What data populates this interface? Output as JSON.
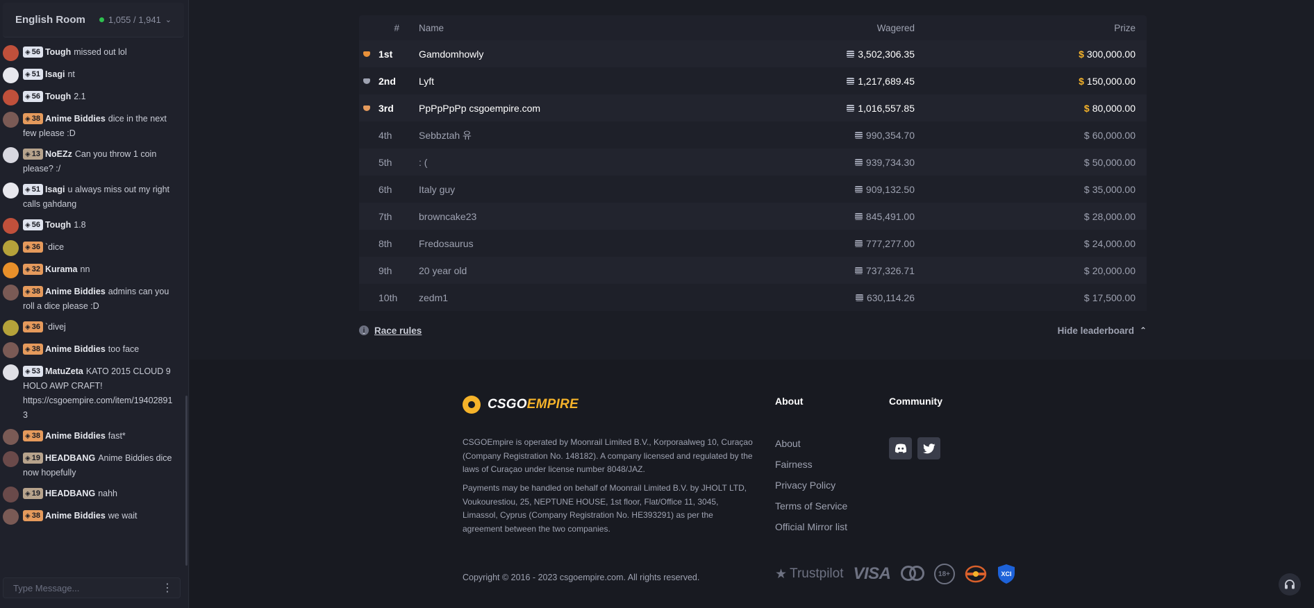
{
  "chat": {
    "room_title": "English Room",
    "online_count": "1,055 / 1,941",
    "input_placeholder": "Type Message...",
    "messages": [
      {
        "user": "Tough",
        "level": "56",
        "level_color": "silver",
        "avatar_color": "#c0503b",
        "text": "missed out lol"
      },
      {
        "user": "Isagi",
        "level": "51",
        "level_color": "silver",
        "avatar_color": "#e8e8ee",
        "text": "nt"
      },
      {
        "user": "Tough",
        "level": "56",
        "level_color": "silver",
        "avatar_color": "#c0503b",
        "text": "2.1"
      },
      {
        "user": "Anime Biddies",
        "level": "38",
        "level_color": "bronze",
        "avatar_color": "#7a5a55",
        "text": "dice in the next few please :D"
      },
      {
        "user": "NoEZz",
        "level": "13",
        "level_color": "tan",
        "avatar_color": "#d8d8e0",
        "text": "Can you throw 1 coin please? :/"
      },
      {
        "user": "Isagi",
        "level": "51",
        "level_color": "silver",
        "avatar_color": "#e8e8ee",
        "text": "u always miss out my right calls gahdang"
      },
      {
        "user": "Tough",
        "level": "56",
        "level_color": "silver",
        "avatar_color": "#c0503b",
        "text": "1.8"
      },
      {
        "user": "",
        "level": "36",
        "level_color": "bronze",
        "avatar_color": "#b5a23a",
        "text": "`dice"
      },
      {
        "user": "Kurama",
        "level": "32",
        "level_color": "bronze",
        "avatar_color": "#e8902a",
        "text": "nn"
      },
      {
        "user": "Anime Biddies",
        "level": "38",
        "level_color": "bronze",
        "avatar_color": "#7a5a55",
        "text": "admins can you roll a dice please :D"
      },
      {
        "user": "",
        "level": "36",
        "level_color": "bronze",
        "avatar_color": "#b5a23a",
        "text": "`divej"
      },
      {
        "user": "Anime Biddies",
        "level": "38",
        "level_color": "bronze",
        "avatar_color": "#7a5a55",
        "text": "too face"
      },
      {
        "user": "MatuZeta",
        "level": "53",
        "level_color": "silver",
        "avatar_color": "#e0e0e6",
        "text": "KATO 2015 CLOUD 9 HOLO AWP CRAFT! https://csgoempire.com/item/19402891 3"
      },
      {
        "user": "Anime Biddies",
        "level": "38",
        "level_color": "bronze",
        "avatar_color": "#7a5a55",
        "text": "fast*"
      },
      {
        "user": "HEADBANG",
        "level": "19",
        "level_color": "tan",
        "avatar_color": "#6a4a4a",
        "text": "Anime Biddies dice now hopefully"
      },
      {
        "user": "HEADBANG",
        "level": "19",
        "level_color": "tan",
        "avatar_color": "#6a4a4a",
        "text": "nahh"
      },
      {
        "user": "Anime Biddies",
        "level": "38",
        "level_color": "bronze",
        "avatar_color": "#7a5a55",
        "text": "we wait"
      }
    ]
  },
  "leaderboard": {
    "headers": {
      "rank": "#",
      "name": "Name",
      "wagered": "Wagered",
      "prize": "Prize"
    },
    "rows": [
      {
        "rank": "1st",
        "name": "Gamdomhowly",
        "wagered": "3,502,306.35",
        "prize": "300,000.00",
        "medal": "#e8913a"
      },
      {
        "rank": "2nd",
        "name": "Lyft",
        "wagered": "1,217,689.45",
        "prize": "150,000.00",
        "medal": "#9ea2b1"
      },
      {
        "rank": "3rd",
        "name": "PpPpPpPp csgoempire.com",
        "wagered": "1,016,557.85",
        "prize": "80,000.00",
        "medal": "#e59a5c"
      },
      {
        "rank": "4th",
        "name": "Sebbztah 유",
        "wagered": "990,354.70",
        "prize": "60,000.00"
      },
      {
        "rank": "5th",
        "name": ": (",
        "wagered": "939,734.30",
        "prize": "50,000.00"
      },
      {
        "rank": "6th",
        "name": "Italy guy",
        "wagered": "909,132.50",
        "prize": "35,000.00"
      },
      {
        "rank": "7th",
        "name": "browncake23",
        "wagered": "845,491.00",
        "prize": "28,000.00"
      },
      {
        "rank": "8th",
        "name": "Fredosaurus",
        "wagered": "777,277.00",
        "prize": "24,000.00"
      },
      {
        "rank": "9th",
        "name": "20 year old",
        "wagered": "737,326.71",
        "prize": "20,000.00"
      },
      {
        "rank": "10th",
        "name": "zedm1",
        "wagered": "630,114.26",
        "prize": "17,500.00"
      }
    ],
    "currency_symbol": "$",
    "race_rules_label": "Race rules",
    "hide_label": "Hide leaderboard"
  },
  "footer": {
    "brand_part1": "CSGO",
    "brand_part2": "EMPIRE",
    "legal1": "CSGOEmpire is operated by Moonrail Limited B.V., Korporaalweg 10, Curaçao (Company Registration No. 148182). A company licensed and regulated by the laws of Curaçao under license number 8048/JAZ.",
    "legal2": "Payments may be handled on behalf of Moonrail Limited B.V. by JHOLT LTD, Voukourestiou, 25, NEPTUNE HOUSE, 1st floor, Flat/Office 11, 3045, Limassol, Cyprus (Company Registration No. HE393291) as per the agreement between the two companies.",
    "copyright": "Copyright © 2016 - 2023 csgoempire.com. All rights reserved.",
    "about_title": "About",
    "community_title": "Community",
    "about_links": [
      "About",
      "Fairness",
      "Privacy Policy",
      "Terms of Service",
      "Official Mirror list"
    ],
    "trustpilot": "Trustpilot",
    "visa": "VISA",
    "age": "18+"
  },
  "colors": {
    "accent": "#f5b32a",
    "online": "#2ec04f"
  }
}
